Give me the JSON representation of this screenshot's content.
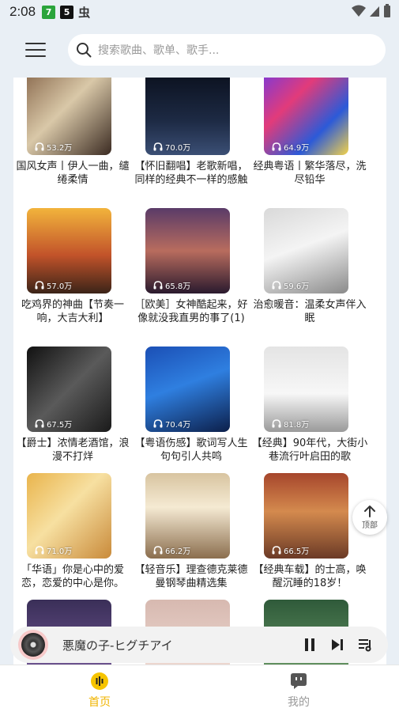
{
  "status_bar": {
    "time": "2:08",
    "badge_a": "7",
    "badge_b": "5",
    "badge_c": "虫"
  },
  "search": {
    "placeholder": "搜索歌曲、歌单、歌手..."
  },
  "playlists": [
    {
      "title": "国风女声丨伊人一曲，缱绻柔情",
      "plays": "53.2万"
    },
    {
      "title": "【怀旧翻唱】老歌新唱，同样的经典不一样的感触",
      "plays": "70.0万"
    },
    {
      "title": "经典粤语丨繁华落尽，洗尽铅华",
      "plays": "64.9万"
    },
    {
      "title": "吃鸡界的神曲【节奏一响，大吉大利】",
      "plays": "57.0万"
    },
    {
      "title": "［欧美］女神酷起来，好像就没我直男的事了(1)",
      "plays": "65.8万"
    },
    {
      "title": "治愈暖音：温柔女声伴入眠",
      "plays": "59.6万"
    },
    {
      "title": "【爵士】浓情老酒馆，浪漫不打烊",
      "plays": "67.5万"
    },
    {
      "title": "【粤语伤感】歌词写人生 句句引人共鸣",
      "plays": "70.4万"
    },
    {
      "title": "【经典】90年代，大街小巷流行叶启田的歌",
      "plays": "81.8万"
    },
    {
      "title": "「华语」你是心中的爱恋，恋爱的中心是你。",
      "plays": "71.0万"
    },
    {
      "title": "【轻音乐】理查德克莱德曼钢琴曲精选集",
      "plays": "66.2万"
    },
    {
      "title": "【经典车载】的士高，唤醒沉睡的18岁！",
      "plays": "66.5万"
    },
    {
      "title": "",
      "plays": ""
    },
    {
      "title": "",
      "plays": ""
    },
    {
      "title": "",
      "plays": ""
    }
  ],
  "back_to_top": {
    "label": "顶部"
  },
  "player": {
    "song": "悪魔の子-ヒグチアイ"
  },
  "tabs": [
    {
      "label": "首页",
      "active": true
    },
    {
      "label": "我的",
      "active": false
    }
  ],
  "colors": {
    "accent": "#f6c400",
    "tab_active": "#f0b400",
    "tab_inactive": "#9a9a9a"
  }
}
